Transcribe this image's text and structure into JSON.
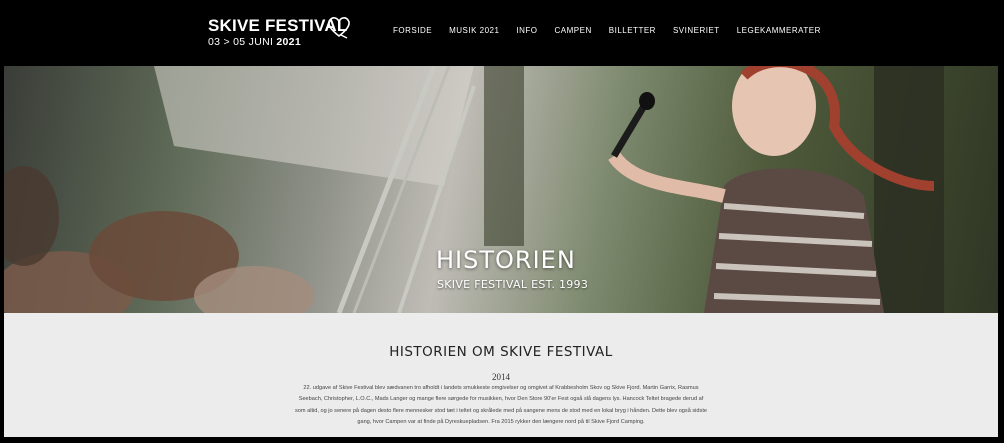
{
  "logo": {
    "title": "SKIVE FESTIVAL",
    "dates_prefix": "03 > 05 JUNI",
    "dates_year": "2021"
  },
  "nav": {
    "items": [
      {
        "label": "FORSIDE"
      },
      {
        "label": "MUSIK 2021"
      },
      {
        "label": "INFO"
      },
      {
        "label": "CAMPEN"
      },
      {
        "label": "BILLETTER"
      },
      {
        "label": "SVINERIET"
      },
      {
        "label": "LEGEKAMMERATER"
      }
    ]
  },
  "hero": {
    "title": "HISTORIEN",
    "subtitle": "SKIVE FESTIVAL EST. 1993"
  },
  "content": {
    "heading": "HISTORIEN OM SKIVE FESTIVAL",
    "year": "2014",
    "paragraph": "22. udgave af Skive Festival blev sædvanen tro afholdt i landets smukkeste omgivelser og omgivet af Krabbesholm Skov og Skive Fjord. Martin Garrix, Rasmus Seebach, Christopher, L.O.C., Mads Langer og mange flere sørgede for musikken, hvor Den Store 90'er Fest også slå dagens lys. Hancock Teltet bragede derud af som altid, og jo senere på dagen desto flere mennesker stod tæt i teltet og skrålede med på sangene mens de stod med en lokal bryg i hånden. Dette blev også sidste gang, hvor Campen var at finde på Dyreskuepladsen. Fra 2015 rykker den længere nord på til Skive Fjord Camping."
  },
  "colors": {
    "header_bg": "#000000",
    "content_bg": "#ececec",
    "text_light": "#ffffff",
    "text_dark": "#222222"
  }
}
